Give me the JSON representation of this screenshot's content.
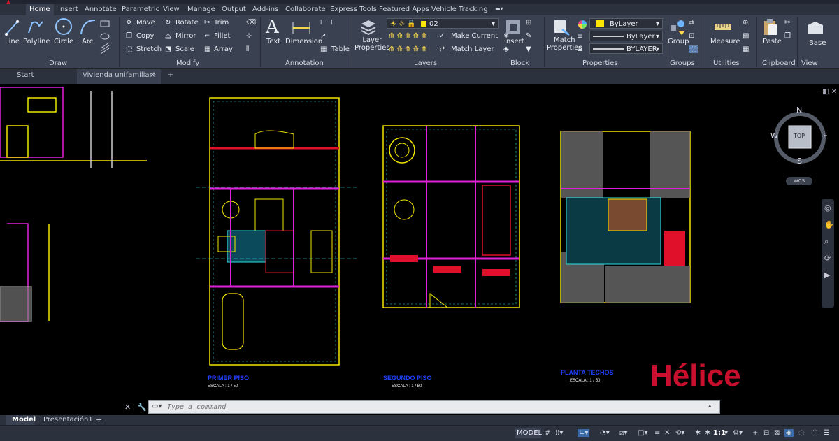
{
  "ribbon_tabs": [
    "Home",
    "Insert",
    "Annotate",
    "Parametric",
    "View",
    "Manage",
    "Output",
    "Add-ins",
    "Collaborate",
    "Express Tools",
    "Featured Apps",
    "Vehicle Tracking"
  ],
  "draw": {
    "line": "Line",
    "polyline": "Polyline",
    "circle": "Circle",
    "arc": "Arc",
    "panel": "Draw"
  },
  "modify": {
    "move": "Move",
    "rotate": "Rotate",
    "trim": "Trim",
    "copy": "Copy",
    "mirror": "Mirror",
    "fillet": "Fillet",
    "stretch": "Stretch",
    "scale": "Scale",
    "array": "Array",
    "panel": "Modify"
  },
  "annotation": {
    "text": "Text",
    "dimension": "Dimension",
    "table": "Table",
    "panel": "Annotation"
  },
  "layers": {
    "layer_properties": "Layer\nProperties",
    "current_layer": "02",
    "make_current": "Make Current",
    "match_layer": "Match Layer",
    "panel": "Layers"
  },
  "block": {
    "insert": "Insert",
    "panel": "Block"
  },
  "properties": {
    "match": "Match\nProperties",
    "color": "ByLayer",
    "linetype": "ByLayer",
    "lineweight": "BYLAYER",
    "panel": "Properties"
  },
  "groups": {
    "group": "Group",
    "panel": "Groups"
  },
  "utilities": {
    "measure": "Measure",
    "panel": "Utilities"
  },
  "clipboard": {
    "paste": "Paste",
    "panel": "Clipboard"
  },
  "view": {
    "base": "Base",
    "panel": "View"
  },
  "doc_tabs": {
    "start": "Start",
    "active": "Vivienda unifamiliar*",
    "add": "+"
  },
  "viewcube": {
    "n": "N",
    "s": "S",
    "e": "E",
    "w": "W",
    "top": "TOP",
    "wcs": "WCS"
  },
  "drawing": {
    "plan1_title": "PRIMER PISO",
    "plan1_scale": "ESCALA :  1 / 50",
    "plan2_title": "SEGUNDO PISO",
    "plan2_scale": "ESCALA :  1 / 50",
    "plan3_title": "PLANTA TECHOS",
    "plan3_scale": "ESCALA :  1 / 50",
    "watermark": "Hélice"
  },
  "command": {
    "placeholder": "Type a command"
  },
  "layout_tabs": [
    "Model",
    "Presentación1",
    "+"
  ],
  "status": {
    "model": "MODEL",
    "scale": "1:1"
  },
  "colors": {
    "ribbon": "#3a4150",
    "canvas": "#000000",
    "yellow": "#f2e600",
    "magenta": "#e020d8",
    "red": "#e0102a",
    "cyan": "#2fe0e0",
    "watermark": "#c8102e",
    "title_blue": "#2040ff"
  }
}
